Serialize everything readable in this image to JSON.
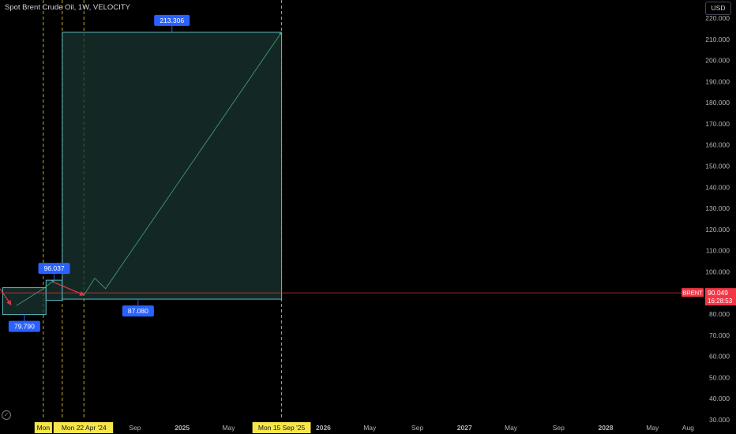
{
  "header": {
    "title": "Spot Brent Crude Oil, 1W, VELOCITY",
    "currency_label": "USD"
  },
  "colors": {
    "background": "#000000",
    "box_border": "#5bbcc4",
    "box_fill": "#1a3530",
    "label_bg": "#2962ff",
    "price_line": "#f23645",
    "dashed_marker": "#f0d238",
    "date_label_bg": "#f6e64a",
    "arrow_red": "#f23645",
    "arrow_green": "#4caf8a"
  },
  "logo_icon": "tradingview-logo-icon",
  "chart_data": {
    "type": "line",
    "title": "Spot Brent Crude Oil, 1W, VELOCITY",
    "ylim": [
      30,
      220
    ],
    "y_ticks": [
      "30.000",
      "40.000",
      "50.000",
      "60.000",
      "70.000",
      "80.000",
      "90.000",
      "100.000",
      "110.000",
      "120.000",
      "130.000",
      "140.000",
      "150.000",
      "160.000",
      "170.000",
      "180.000",
      "190.000",
      "200.000",
      "210.000",
      "220.000"
    ],
    "y_tick_values": [
      30,
      40,
      50,
      60,
      70,
      80,
      90,
      100,
      110,
      120,
      130,
      140,
      150,
      160,
      170,
      180,
      190,
      200,
      210,
      220
    ],
    "x_range": [
      "2023-09-18",
      "2028-09-04"
    ],
    "x_ticks": [
      {
        "label": "Sep",
        "date": "2024-09-01"
      },
      {
        "label": "2025",
        "date": "2025-01-01"
      },
      {
        "label": "May",
        "date": "2025-05-01"
      },
      {
        "label": "2026",
        "date": "2026-01-01"
      },
      {
        "label": "May",
        "date": "2026-05-01"
      },
      {
        "label": "Sep",
        "date": "2026-09-01"
      },
      {
        "label": "2027",
        "date": "2027-01-01"
      },
      {
        "label": "May",
        "date": "2027-05-01"
      },
      {
        "label": "Sep",
        "date": "2027-09-01"
      },
      {
        "label": "2028",
        "date": "2028-01-01"
      },
      {
        "label": "May",
        "date": "2028-05-01"
      },
      {
        "label": "Aug",
        "date": "2028-08-01"
      }
    ],
    "current_price": {
      "symbol": "BRENT",
      "value": 90.049,
      "label": "90.049",
      "countdown": "16:28:53"
    },
    "boxes": [
      {
        "x0": "2023-09-25",
        "x1": "2024-01-15",
        "y_low": 79.79,
        "y_high": 92.5,
        "label": "79.790",
        "label_anchor": "bottom"
      },
      {
        "x0": "2024-01-15",
        "x1": "2024-02-26",
        "y_low": 86.5,
        "y_high": 96.037,
        "label": "96.037",
        "label_anchor": "top"
      },
      {
        "x0": "2024-02-26",
        "x1": "2025-09-15",
        "y_low": 87.08,
        "y_high": 213.306,
        "label_top": "213.306",
        "label_bottom": "87.080"
      }
    ],
    "dashed_markers": [
      {
        "date": "2024-01-08",
        "label": "Mon"
      },
      {
        "date": "2024-02-26",
        "label": "Mon"
      },
      {
        "date": "2024-04-22",
        "label": "Mon 22 Apr '24"
      },
      {
        "date": "2025-09-15",
        "label": "Mon 15 Sep '25"
      }
    ],
    "paths": [
      {
        "color": "red",
        "points": [
          [
            "2023-09-18",
            92
          ],
          [
            "2023-10-16",
            84.5
          ]
        ]
      },
      {
        "color": "green",
        "points": [
          [
            "2023-10-30",
            84
          ],
          [
            "2024-01-08",
            92
          ],
          [
            "2024-02-05",
            96
          ]
        ]
      },
      {
        "color": "red",
        "points": [
          [
            "2024-02-05",
            95
          ],
          [
            "2024-04-22",
            89
          ]
        ]
      },
      {
        "color": "green",
        "points": [
          [
            "2024-04-22",
            89
          ],
          [
            "2024-05-20",
            97
          ],
          [
            "2024-06-17",
            92
          ],
          [
            "2025-09-15",
            213.306
          ]
        ]
      }
    ]
  }
}
